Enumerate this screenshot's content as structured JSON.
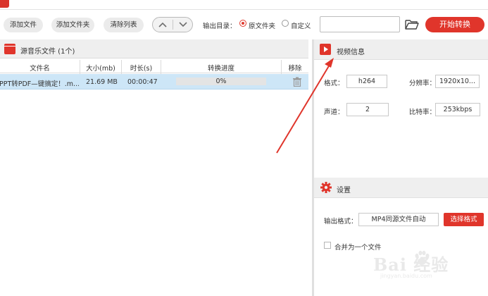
{
  "toolbar": {
    "add_file": "添加文件",
    "add_folder": "添加文件夹",
    "clear_list": "清除列表",
    "output_dir_label": "输出目录：",
    "radio_original": "原文件夹",
    "radio_custom": "自定义",
    "output_path_value": "",
    "start_button": "开始转换"
  },
  "file_panel": {
    "title": "源音乐文件 (1个)",
    "columns": {
      "name": "文件名",
      "size": "大小(mb)",
      "duration": "时长(s)",
      "progress": "转换进度",
      "remove": "移除"
    },
    "rows": [
      {
        "name": "PPT转PDF—键搞定！.m...",
        "size": "21.69 MB",
        "duration": "00:00:47",
        "progress_text": "0%",
        "progress_value": 0
      }
    ]
  },
  "video_info": {
    "title": "视频信息",
    "format_label": "格式：",
    "format_value": "h264",
    "resolution_label": "分辨率：",
    "resolution_value": "1920x10...",
    "channels_label": "声道：",
    "channels_value": "2",
    "bitrate_label": "比特率：",
    "bitrate_value": "253kbps"
  },
  "settings": {
    "title": "设置",
    "output_format_label": "输出格式：",
    "output_format_value": "MP4同源文件自动",
    "choose_format_button": "选择格式",
    "merge_label": "合并为一个文件",
    "merge_checked": false
  },
  "watermark": {
    "brand": "Bai 经验",
    "url": "jingyan.baidu.com"
  },
  "colors": {
    "accent": "#e0352b",
    "row_selected": "#cde6f7",
    "panel_header": "#efefef",
    "annotation_arrow": "#e0352b"
  },
  "icons": {
    "logo": "app-logo-icon",
    "nav_up": "chevron-up-icon",
    "nav_down": "chevron-down-icon",
    "folder": "folder-open-icon",
    "film": "film-icon",
    "trash": "trash-icon",
    "video": "video-play-icon",
    "settings": "gear-icon"
  }
}
